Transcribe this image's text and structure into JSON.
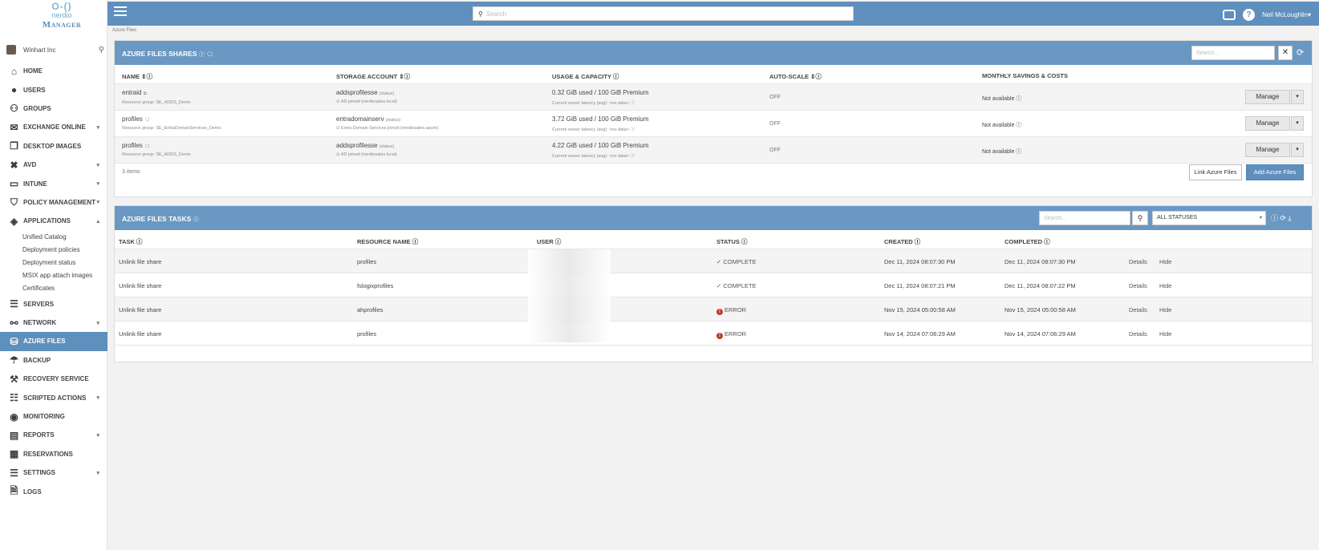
{
  "logo": {
    "line1": "O-()",
    "line2": "nerdio",
    "line3": "Manager"
  },
  "tenant": {
    "name": "Winhart Inc"
  },
  "nav": {
    "home": "HOME",
    "users": "USERS",
    "groups": "GROUPS",
    "exchange": "EXCHANGE ONLINE",
    "desktop_images": "DESKTOP IMAGES",
    "avd": "AVD",
    "intune": "INTUNE",
    "policy": "POLICY MANAGEMENT",
    "applications": "APPLICATIONS",
    "app_sub": [
      "Unified Catalog",
      "Deployment policies",
      "Deployment status",
      "MSIX app attach images",
      "Certificates"
    ],
    "servers": "SERVERS",
    "network": "NETWORK",
    "azure_files": "AZURE FILES",
    "backup": "BACKUP",
    "recovery": "RECOVERY SERVICE",
    "scripted": "SCRIPTED ACTIONS",
    "monitoring": "MONITORING",
    "reports": "REPORTS",
    "reservations": "RESERVATIONS",
    "settings": "SETTINGS",
    "logs": "LOGS"
  },
  "topbar": {
    "search_placeholder": "Search",
    "user": "Neil McLoughlin▾"
  },
  "breadcrumb": "Azure Files",
  "shares": {
    "title": "AZURE FILES SHARES",
    "title_icons": "ⓘ 🗨",
    "search_placeholder": "Search...",
    "clear": "✕",
    "refresh": "⟳",
    "columns": {
      "name": "NAME ⇕ⓘ",
      "storage": "STORAGE ACCOUNT ⇕ⓘ",
      "usage": "USAGE & CAPACITY ⓘ",
      "autoscale": "AUTO-SCALE ⇕ⓘ",
      "savings": "MONTHLY SAVINGS & COSTS"
    },
    "rows": [
      {
        "name": "entraid",
        "name_icon": "⧉",
        "rg": "Resource group: SE_ADDS_Demo",
        "account": "addsprofilesse",
        "account_tag": "(status)",
        "join": "⊙ AD joined (nerdiosales.local)",
        "usage": "0.32 GiB used / 100 GiB Premium",
        "latency": "Current server latency (avg): <no data> ⓘ",
        "autoscale": "OFF",
        "savings": "Not available ⓘ",
        "manage": "Manage",
        "caret": "▾"
      },
      {
        "name": "profiles",
        "name_icon": "🗨",
        "rg": "Resource group: SE_EntraDomainServices_Demo",
        "account": "entradomainserv",
        "account_tag": "(status)",
        "join": "⊙ Entra Domain Services joined (nerdiosales.azure)",
        "usage": "3.72 GiB used / 100 GiB Premium",
        "latency": "Current server latency (avg): <no data> ⓘ",
        "autoscale": "OFF",
        "savings": "Not available ⓘ",
        "manage": "Manage",
        "caret": "▾"
      },
      {
        "name": "profiles",
        "name_icon": "🗨",
        "rg": "Resource group: SE_ADDS_Demo",
        "account": "addsprofilesse",
        "account_tag": "(status)",
        "join": "⊙ AD joined (nerdiosales.local)",
        "usage": "4.22 GiB used / 100 GiB Premium",
        "latency": "Current server latency (avg): <no data> ⓘ",
        "autoscale": "OFF",
        "savings": "Not available ⓘ",
        "manage": "Manage",
        "caret": "▾"
      }
    ],
    "count": "3 items",
    "link_button": "Link Azure Files",
    "add_button": "Add Azure Files"
  },
  "tasks": {
    "title": "AZURE FILES TASKS",
    "title_icon": "ⓘ",
    "search_placeholder": "Search...",
    "search_btn": "⚲",
    "status_filter": "ALL STATUSES",
    "status_caret": "▾",
    "tools": "ⓘ ⟳ ⤓",
    "columns": {
      "task": "TASK ⓘ",
      "resource": "RESOURCE NAME ⓘ",
      "user": "USER ⓘ",
      "status": "STATUS ⓘ",
      "created": "CREATED ⓘ",
      "completed": "COMPLETED ⓘ"
    },
    "rows": [
      {
        "task": "Unlink file share",
        "resource": "profiles",
        "status": "✓ COMPLETE",
        "error": false,
        "created": "Dec 11, 2024 08:07:30 PM",
        "completed": "Dec 11, 2024 08:07:30 PM",
        "details": "Details",
        "hide": "Hide"
      },
      {
        "task": "Unlink file share",
        "resource": "fslogixprofiles",
        "status": "✓ COMPLETE",
        "error": false,
        "created": "Dec 11, 2024 08:07:21 PM",
        "completed": "Dec 11, 2024 08:07:22 PM",
        "details": "Details",
        "hide": "Hide"
      },
      {
        "task": "Unlink file share",
        "resource": "ahprofiles",
        "status": "ERROR",
        "error": true,
        "created": "Nov 15, 2024 05:00:58 AM",
        "completed": "Nov 15, 2024 05:00:58 AM",
        "details": "Details",
        "hide": "Hide"
      },
      {
        "task": "Unlink file share",
        "resource": "profiles",
        "status": "ERROR",
        "error": true,
        "created": "Nov 14, 2024 07:06:29 AM",
        "completed": "Nov 14, 2024 07:06:29 AM",
        "details": "Details",
        "hide": "Hide"
      }
    ],
    "error_glyph": "!"
  }
}
